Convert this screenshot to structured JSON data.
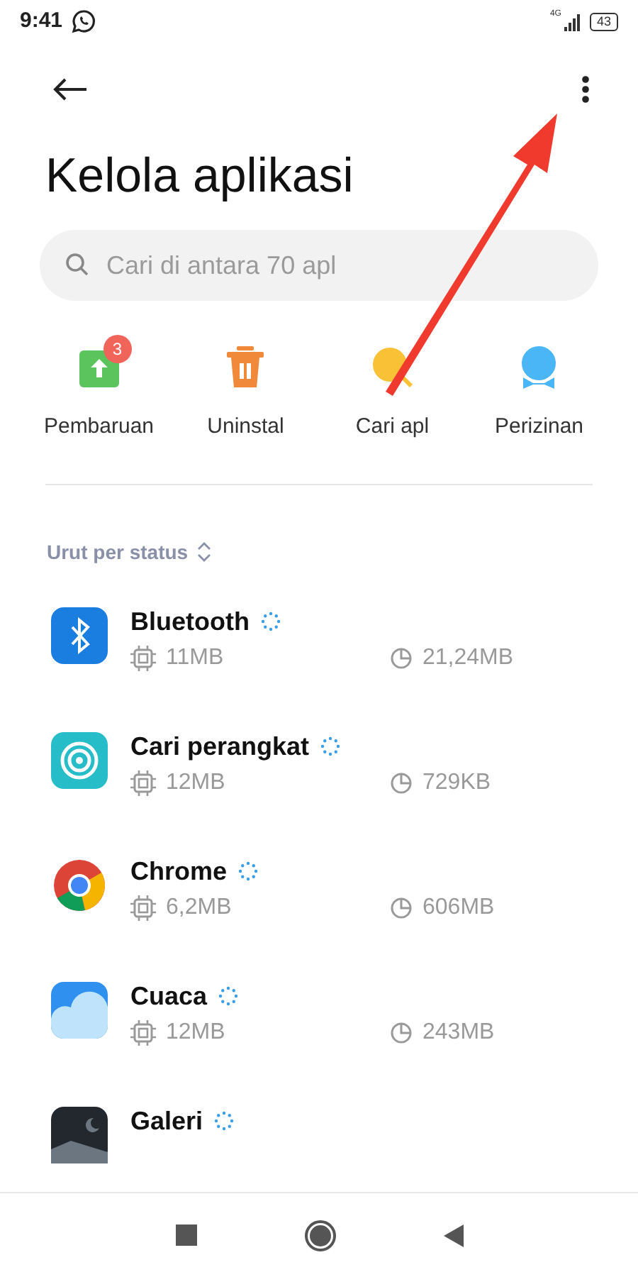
{
  "status_bar": {
    "time": "9:41",
    "network": "4G",
    "battery": "43"
  },
  "title": "Kelola aplikasi",
  "search": {
    "placeholder": "Cari di antara 70 apl"
  },
  "shortcuts": [
    {
      "label": "Pembaruan",
      "badge": "3"
    },
    {
      "label": "Uninstal"
    },
    {
      "label": "Cari apl"
    },
    {
      "label": "Perizinan"
    }
  ],
  "sort": {
    "label": "Urut per status"
  },
  "apps": [
    {
      "name": "Bluetooth",
      "loading": true,
      "memory": "11MB",
      "storage": "21,24MB"
    },
    {
      "name": "Cari perangkat",
      "loading": true,
      "memory": "12MB",
      "storage": "729KB"
    },
    {
      "name": "Chrome",
      "loading": true,
      "memory": "6,2MB",
      "storage": "606MB"
    },
    {
      "name": "Cuaca",
      "loading": true,
      "memory": "12MB",
      "storage": "243MB"
    },
    {
      "name": "Galeri",
      "loading": true
    }
  ]
}
